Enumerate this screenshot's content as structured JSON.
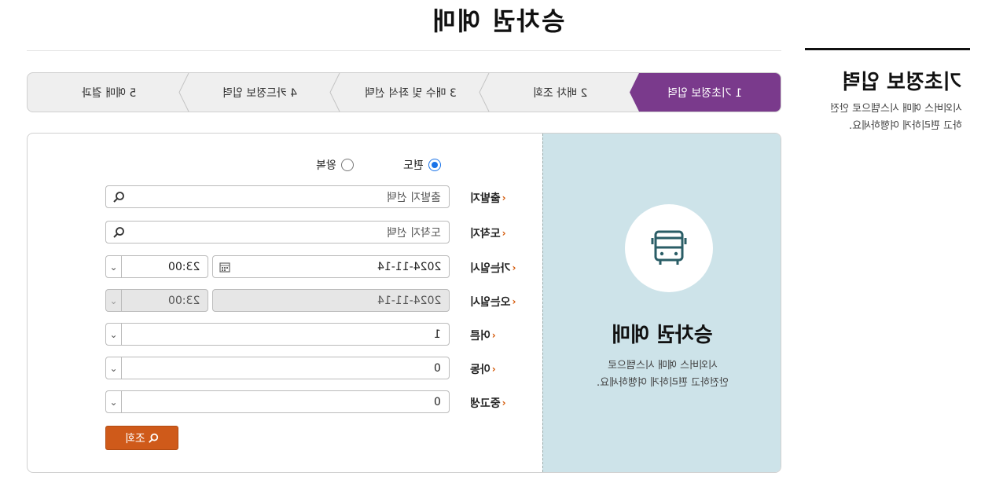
{
  "page": {
    "title": "승차권 예매"
  },
  "sidebar": {
    "title": "기초정보 입력",
    "desc_line1": "시외버스 예매 시스템으로 안전",
    "desc_line2": "하고 편리하게 여행하세요."
  },
  "steps": [
    {
      "label": "1 기초정보 입력",
      "active": true
    },
    {
      "label": "2 배차 조회",
      "active": false
    },
    {
      "label": "3 매수 및 좌석 선택",
      "active": false
    },
    {
      "label": "4 카드정보 입력",
      "active": false
    },
    {
      "label": "5 예매 결과",
      "active": false
    }
  ],
  "trip": {
    "one_way_label": "편도",
    "round_trip_label": "왕복",
    "selected": "one_way"
  },
  "form": {
    "departure": {
      "label": "출발지",
      "placeholder": "출발지 선택"
    },
    "arrival": {
      "label": "도착지",
      "placeholder": "도착지 선택"
    },
    "outbound": {
      "label": "가는일시",
      "date": "2024-11-14",
      "time": "23:00"
    },
    "return": {
      "label": "오는일시",
      "date": "2024-11-14",
      "time": "23:00"
    },
    "adult": {
      "label": "어른",
      "value": "1"
    },
    "child": {
      "label": "아동",
      "value": "0"
    },
    "student": {
      "label": "중고생",
      "value": "0"
    },
    "search_button": "조회"
  },
  "panel": {
    "title": "승차권 예매",
    "desc_line1": "시외버스 예매 시스템으로",
    "desc_line2": "안전하고 편리하게 여행하세요."
  },
  "colors": {
    "active_step": "#7a3a8c",
    "search_button": "#cf5a1a",
    "panel_bg": "#cde3e9",
    "radio_on": "#1a73e8",
    "bus_icon": "#2a5d66"
  }
}
